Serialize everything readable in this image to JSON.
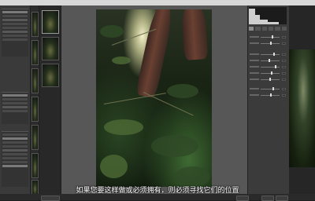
{
  "menubar": {
    "items": [
      "",
      "",
      "",
      "",
      "",
      ""
    ]
  },
  "bottom_bar": {
    "left_button": "",
    "save_button": "",
    "open_button": "",
    "done_button": ""
  },
  "subtitle": "如果您要这样做或必须拥有，则必须寻找它们的位置",
  "colors": {
    "background": "#1e1e1e",
    "panel": "#3b3b3b",
    "main_background": "#575757"
  }
}
